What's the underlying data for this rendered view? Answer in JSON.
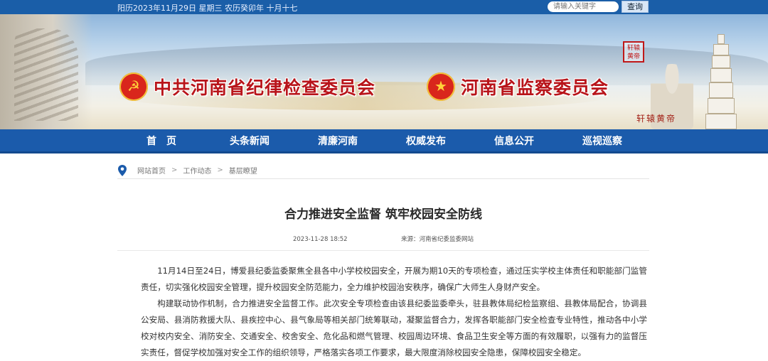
{
  "topbar": {
    "date": "阳历2023年11月29日 星期三 农历癸卯年 十月十七",
    "search_placeholder": "请输入关键字",
    "search_label": "查询"
  },
  "banner": {
    "title_left": "中共河南省纪律检查委员会",
    "title_right": "河南省监察委员会",
    "seal_text": "轩辕黄帝",
    "calligraphy": "轩辕黄帝"
  },
  "nav": {
    "items": [
      {
        "label": "首　页"
      },
      {
        "label": "头条新闻"
      },
      {
        "label": "清廉河南"
      },
      {
        "label": "权威发布"
      },
      {
        "label": "信息公开"
      },
      {
        "label": "巡视巡察"
      }
    ]
  },
  "breadcrumb": {
    "items": [
      "网站首页",
      "工作动态",
      "基层瞭望"
    ],
    "separator": ">"
  },
  "article": {
    "title": "合力推进安全监督 筑牢校园安全防线",
    "date": "2023-11-28 18:52",
    "source_label": "来源：",
    "source": "河南省纪委监委网站",
    "paragraphs": [
      "11月14日至24日，博爱县纪委监委聚焦全县各中小学校校园安全，开展为期10天的专项检查，通过压实学校主体责任和职能部门监管责任，切实强化校园安全管理，提升校园安全防范能力，全力维护校园治安秩序，确保广大师生人身财产安全。",
      "构建联动协作机制，合力推进安全监督工作。此次安全专项检查由该县纪委监委牵头，驻县教体局纪检监察组、县教体局配合，协调县公安局、县消防救援大队、县疾控中心、县气象局等相关部门统筹联动，凝聚监督合力，发挥各职能部门安全检查专业特性，推动各中小学校对校内安全、消防安全、交通安全、校舍安全、危化品和燃气管理、校园周边环境、食品卫生安全等方面的有效履职，以强有力的监督压实责任，督促学校加强对安全工作的组织领导，严格落实各项工作要求，最大限度消除校园安全隐患，保障校园安全稳定。"
    ]
  },
  "colors": {
    "nav_bg": "#1b5bab",
    "title_red": "#b8141a"
  }
}
